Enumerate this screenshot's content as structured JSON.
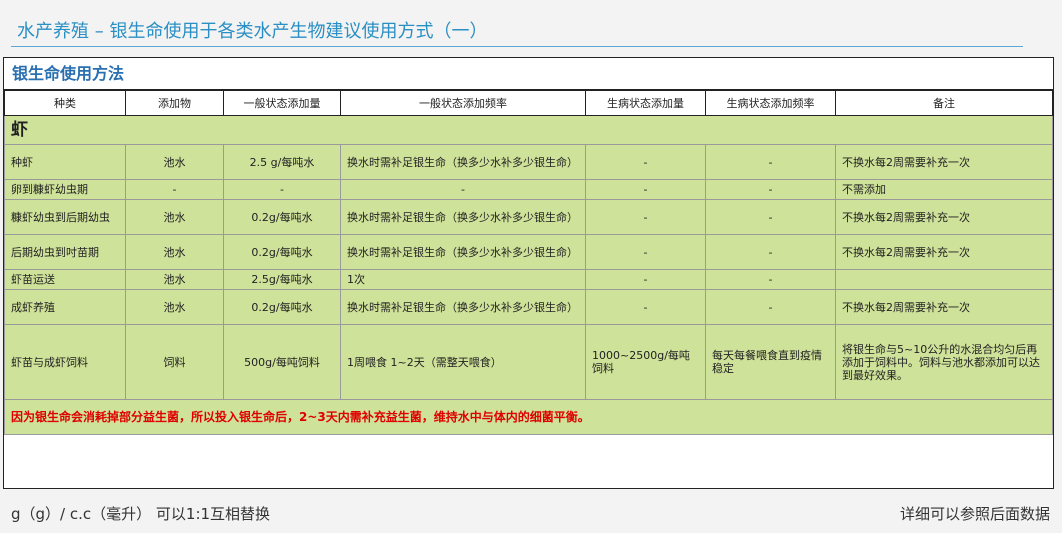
{
  "page_title": "水产养殖 – 银生命使用于各类水产生物建议使用方式（一）",
  "table_title": "银生命使用方法",
  "headers": [
    "种类",
    "添加物",
    "一般状态添加量",
    "一般状态添加频率",
    "生病状态添加量",
    "生病状态添加频率",
    "备注"
  ],
  "section": "虾",
  "rows": [
    {
      "kind": "种虾",
      "additive": "池水",
      "normal_amount": "2.5 g/每吨水",
      "normal_freq": "换水时需补足银生命（换多少水补多少银生命）",
      "sick_amount": "-",
      "sick_freq": "-",
      "note": "不换水每2周需要补充一次"
    },
    {
      "kind": "卵到糠虾幼虫期",
      "additive": "-",
      "normal_amount": "-",
      "normal_freq": "-",
      "sick_amount": "-",
      "sick_freq": "-",
      "note": "不需添加"
    },
    {
      "kind": "糠虾幼虫到后期幼虫",
      "additive": "池水",
      "normal_amount": "0.2g/每吨水",
      "normal_freq": "换水时需补足银生命（换多少水补多少银生命）",
      "sick_amount": "-",
      "sick_freq": "-",
      "note": "不换水每2周需要补充一次"
    },
    {
      "kind": "后期幼虫到吋苗期",
      "additive": "池水",
      "normal_amount": "0.2g/每吨水",
      "normal_freq": "换水时需补足银生命（换多少水补多少银生命）",
      "sick_amount": "-",
      "sick_freq": "-",
      "note": "不换水每2周需要补充一次"
    },
    {
      "kind": "虾苗运送",
      "additive": "池水",
      "normal_amount": "2.5g/每吨水",
      "normal_freq": "1次",
      "sick_amount": "-",
      "sick_freq": "-",
      "note": ""
    },
    {
      "kind": "成虾养殖",
      "additive": "池水",
      "normal_amount": "0.2g/每吨水",
      "normal_freq": "换水时需补足银生命（换多少水补多少银生命）",
      "sick_amount": "-",
      "sick_freq": "-",
      "note": "不换水每2周需要补充一次"
    },
    {
      "kind": "虾苗与成虾饲料",
      "additive": "饲料",
      "normal_amount": "500g/每吨饲料",
      "normal_freq": "1周喂食 1~2天（需整天喂食）",
      "sick_amount": "1000~2500g/每吨饲料",
      "sick_freq": "每天每餐喂食直到疫情稳定",
      "note": "将银生命与5~10公升的水混合均匀后再添加于饲料中。饲料与池水都添加可以达到最好效果。"
    }
  ],
  "warning": "因为银生命会消耗掉部分益生菌，所以投入银生命后，2~3天内需补充益生菌，维持水中与体内的细菌平衡。",
  "footer_left": "g（g）/ c.c（毫升） 可以1:1互相替换",
  "footer_right": "详细可以参照后面数据"
}
